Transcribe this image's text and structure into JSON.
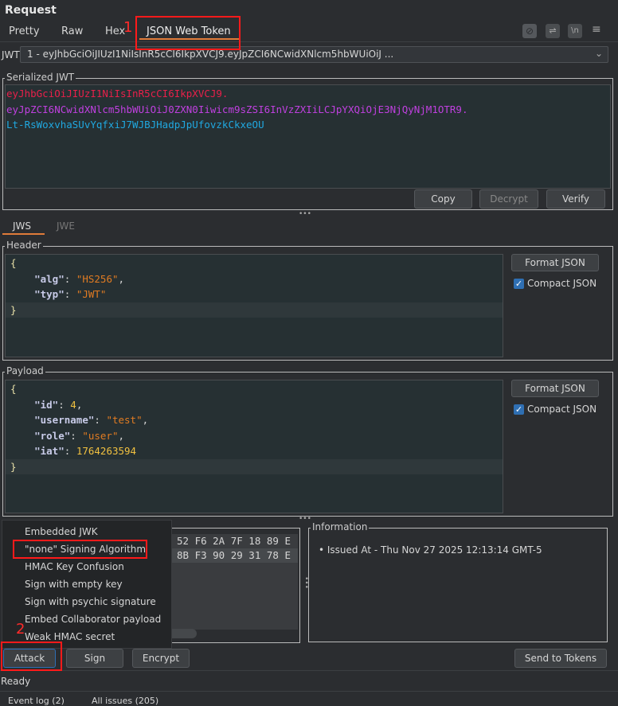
{
  "panel_title": "Request",
  "tabs": [
    {
      "label": "Pretty"
    },
    {
      "label": "Raw"
    },
    {
      "label": "Hex"
    },
    {
      "label": "JSON Web Token"
    }
  ],
  "toolbar_icons": [
    "hide-icon",
    "wrap-icon",
    "newline-icon",
    "menu-icon"
  ],
  "jwt_select": {
    "label": "JWT",
    "value": "1 - eyJhbGciOiJIUzI1NiIsInR5cCI6IkpXVCJ9.eyJpZCI6NCwidXNlcm5hbWUiOiJ ..."
  },
  "serialized": {
    "legend": "Serialized JWT",
    "header": "eyJhbGciOiJIUzI1NiIsInR5cCI6IkpXVCJ9.",
    "payload": "eyJpZCI6NCwidXNlcm5hbWUiOiJ0ZXN0Iiwicm9sZSI6InVzZXIiLCJpYXQiOjE3NjQyNjM1OTR9.",
    "signature": "Lt-RsWoxvhaSUvYqfxiJ7WJBJHadpJpUfovzkCkxeOU",
    "buttons": {
      "copy": "Copy",
      "decrypt": "Decrypt",
      "verify": "Verify"
    }
  },
  "subtabs": [
    {
      "label": "JWS"
    },
    {
      "label": "JWE"
    }
  ],
  "header_section": {
    "legend": "Header",
    "open": "{",
    "close": "}",
    "entries": [
      {
        "key": "\"alg\"",
        "value": "\"HS256\"",
        "sep": ",",
        "type": "s"
      },
      {
        "key": "\"typ\"",
        "value": "\"JWT\"",
        "sep": "",
        "type": "s"
      }
    ],
    "format": "Format JSON",
    "compact": "Compact JSON",
    "compact_checked": true
  },
  "payload_section": {
    "legend": "Payload",
    "open": "{",
    "close": "}",
    "entries": [
      {
        "key": "\"id\"",
        "value": "4",
        "sep": ",",
        "type": "n"
      },
      {
        "key": "\"username\"",
        "value": "\"test\"",
        "sep": ",",
        "type": "s"
      },
      {
        "key": "\"role\"",
        "value": "\"user\"",
        "sep": ",",
        "type": "s"
      },
      {
        "key": "\"iat\"",
        "value": "1764263594",
        "sep": "",
        "type": "n"
      }
    ],
    "format": "Format JSON",
    "compact": "Compact JSON",
    "compact_checked": true
  },
  "hex_rows": [
    "52 F6 2A 7F 18 89 E",
    "8B F3 90 29 31 78 E"
  ],
  "information": {
    "legend": "Information",
    "items": [
      "• Issued At - Thu Nov 27 2025 12:13:14 GMT-5"
    ]
  },
  "attack_menu": [
    "Embedded JWK",
    "\"none\" Signing Algorithm",
    "HMAC Key Confusion",
    "Sign with empty key",
    "Sign with psychic signature",
    "Embed Collaborator payload",
    "Weak HMAC secret"
  ],
  "bottom_buttons": {
    "attack": "Attack",
    "sign": "Sign",
    "encrypt": "Encrypt",
    "send": "Send to Tokens"
  },
  "status": "Ready",
  "footer": {
    "event_log": "Event log (2)",
    "issues": "All issues (205)"
  },
  "annotations": {
    "one": "1",
    "two": "2"
  }
}
